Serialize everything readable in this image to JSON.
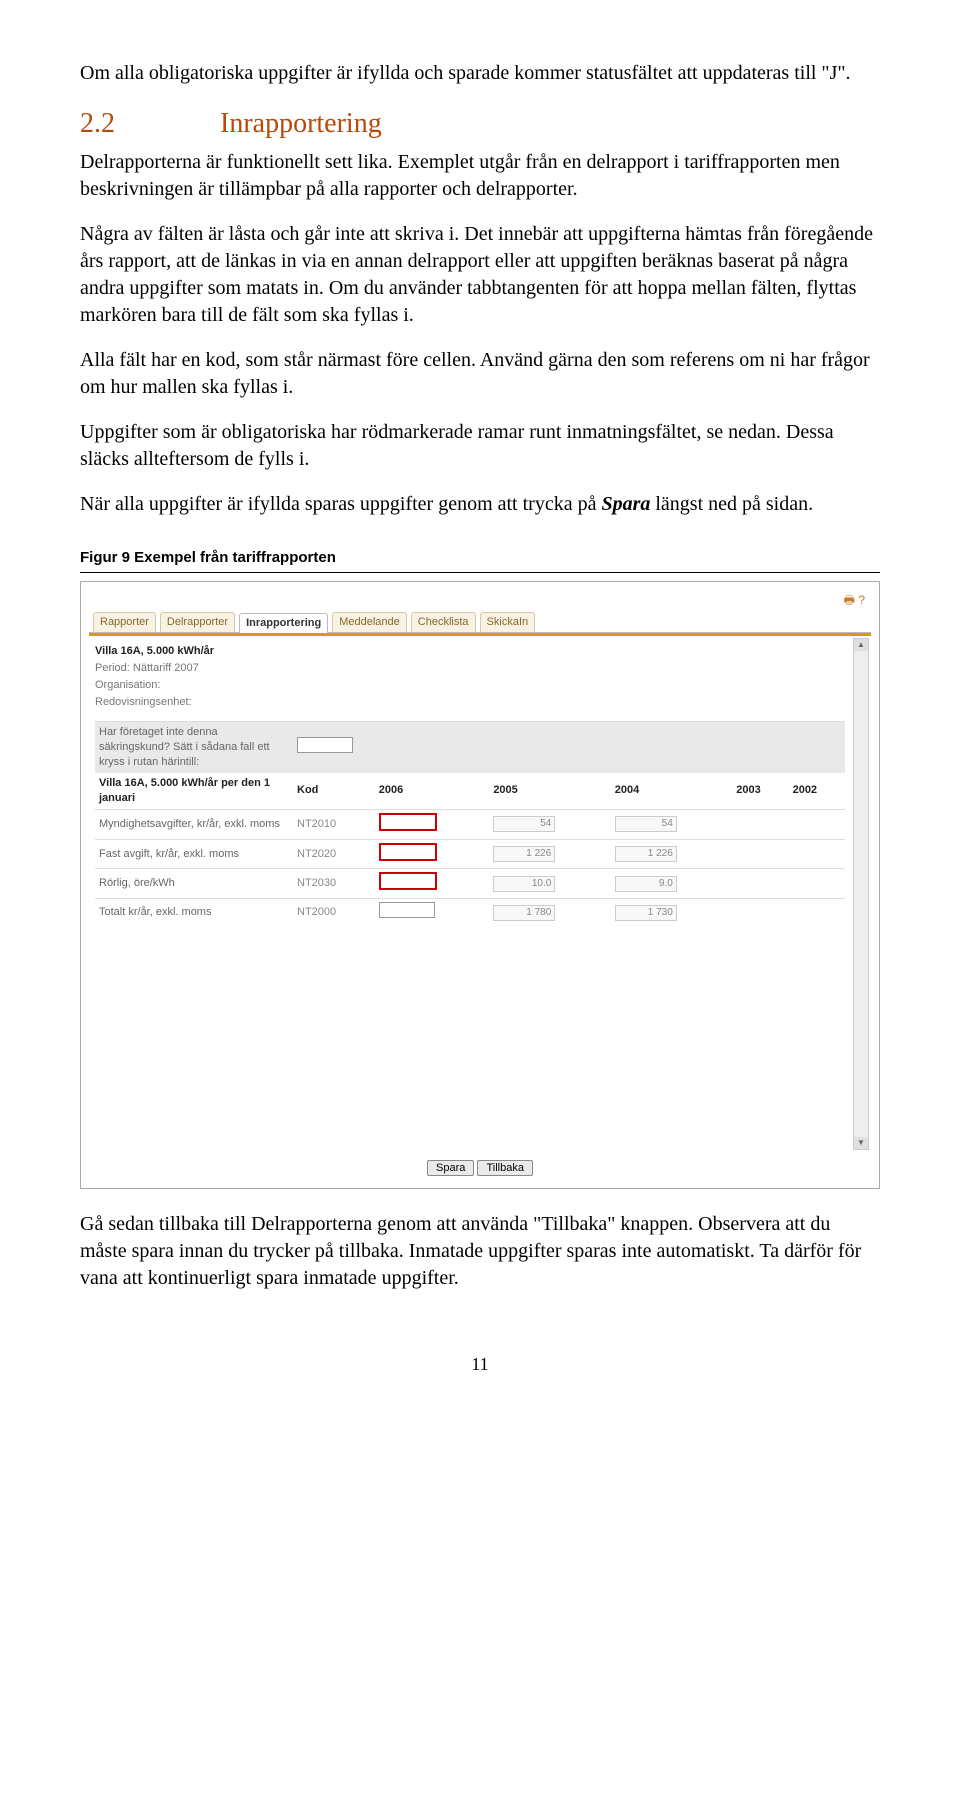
{
  "para1": "Om alla obligatoriska uppgifter är ifyllda och sparade kommer statusfältet att uppdateras till \"J\".",
  "section": {
    "num": "2.2",
    "title": "Inrapportering"
  },
  "para2a": "Delrapporterna är funktionellt sett lika. Exemplet utgår från en delrapport i tariffrapporten men beskrivningen är tillämpbar på alla rapporter och delrapporter.",
  "para3": "Några av fälten är låsta och går inte att skriva i. Det innebär att uppgifterna hämtas från föregående års rapport, att de länkas in via en annan delrapport eller att uppgiften beräknas baserat på några andra uppgifter som matats in. Om du använder tabbtangenten för att hoppa mellan fälten, flyttas markören bara till de fält som ska fyllas i.",
  "para4": "Alla fält har en kod, som står närmast före cellen. Använd gärna den som referens om ni har frågor om hur mallen ska fyllas i.",
  "para5": "Uppgifter som är obligatoriska har rödmarkerade ramar runt inmatningsfältet, se nedan. Dessa släcks alltefter­som de fylls i.",
  "para6a": "När alla uppgifter är ifyllda sparas uppgifter genom att trycka på ",
  "para6b": "Spara",
  "para6c": " längst ned på sidan.",
  "figure_caption": "Figur 9 Exempel från tariffrapporten",
  "screenshot": {
    "tabs": [
      "Rapporter",
      "Delrapporter",
      "Inrapportering",
      "Meddelande",
      "Checklista",
      "SkickaIn"
    ],
    "active_tab_index": 2,
    "heading": "Villa 16A, 5.000 kWh/år",
    "meta": [
      "Period: Nättariff 2007",
      "Organisation:",
      "Redovisningsenhet:"
    ],
    "question": "Har företaget inte denna säkringskund? Sätt i sådana fall ett kryss i rutan härintill:",
    "subheading": "Villa 16A, 5.000 kWh/år per den 1 januari",
    "cols": [
      "Kod",
      "2006",
      "2005",
      "2004",
      "2003",
      "2002"
    ],
    "rows": [
      {
        "label": "Myndighetsavgifter, kr/år, exkl. moms",
        "kod": "NT2010",
        "req": true,
        "v2005": "54",
        "v2004": "54"
      },
      {
        "label": "Fast avgift, kr/år, exkl. moms",
        "kod": "NT2020",
        "req": true,
        "v2005": "1 226",
        "v2004": "1 226"
      },
      {
        "label": "Rörlig, öre/kWh",
        "kod": "NT2030",
        "req": true,
        "v2005": "10.0",
        "v2004": "9.0"
      },
      {
        "label": "Totalt kr/år, exkl. moms",
        "kod": "NT2000",
        "req": false,
        "v2005": "1 780",
        "v2004": "1 730"
      }
    ],
    "buttons": {
      "save": "Spara",
      "back": "Tillbaka"
    }
  },
  "para7": "Gå sedan tillbaka till Delrapporterna genom att använda \"Tillbaka\" knappen. Observera att du måste spara innan du trycker på tillbaka. Inmatade uppgifter sparas inte automatiskt. Ta därför för vana att kontinuerligt spara inmatade uppgifter.",
  "page_number": "11"
}
